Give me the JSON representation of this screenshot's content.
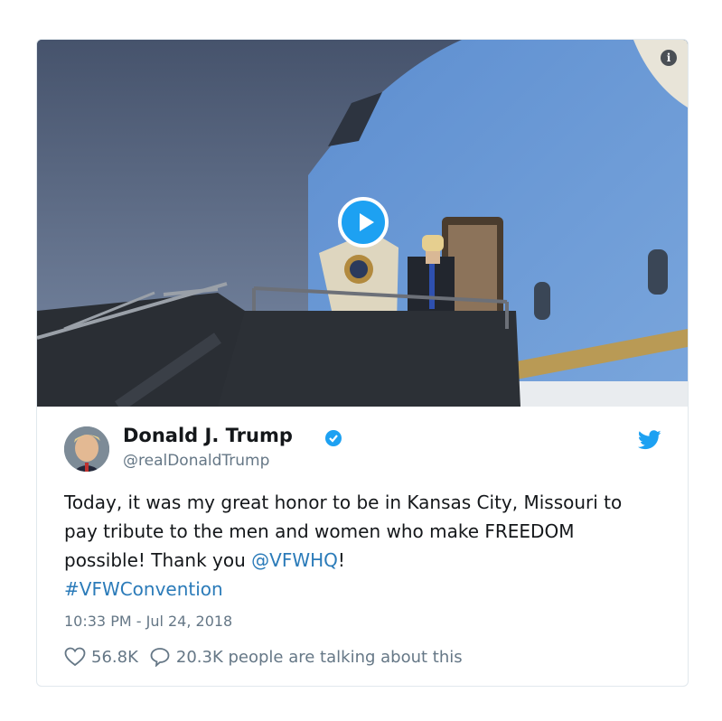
{
  "tweet": {
    "author_name": "Donald J. Trump",
    "author_handle": "@realDonaldTrump",
    "text_part1": "Today, it was my great honor to be in Kansas City, Missouri to pay tribute to the men and women who make FREEDOM possible! Thank you ",
    "mention": "@VFWHQ",
    "text_part2": "!",
    "hashtag": "#VFWConvention",
    "timestamp": "10:33 PM - Jul 24, 2018",
    "likes": "56.8K",
    "replies_text": "20.3K people are talking about this"
  },
  "media": {
    "info_glyph": "i",
    "icons": [
      "play-icon",
      "info-icon"
    ]
  },
  "icons": {
    "verified": "verified-badge-icon",
    "twitter": "twitter-bird-icon",
    "heart": "heart-icon",
    "reply": "speech-bubble-icon"
  },
  "colors": {
    "link": "#2b7bb9",
    "twitter_blue": "#1da1f2",
    "muted": "#657786",
    "text": "#14171a"
  }
}
